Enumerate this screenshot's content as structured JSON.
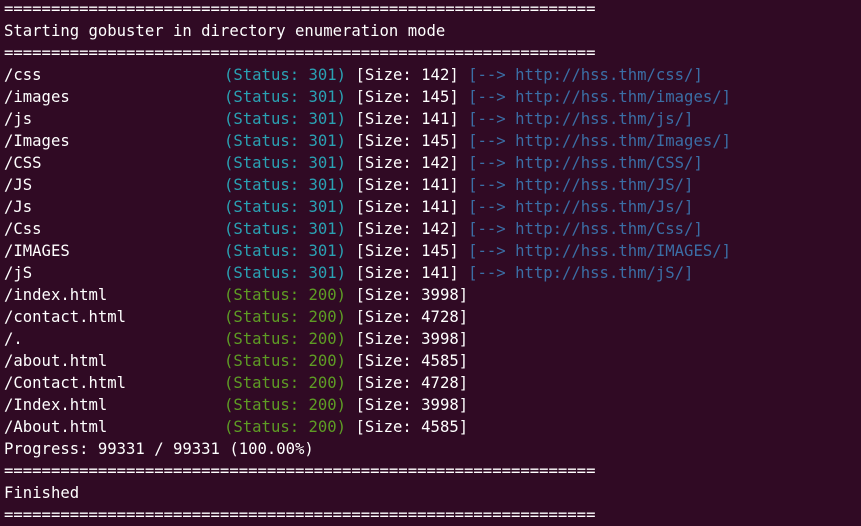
{
  "terminal": {
    "separator": "===============================================================",
    "header": "Starting gobuster in directory enumeration mode",
    "results": [
      {
        "path": "/css",
        "status": "(Status: 301)",
        "code": "301",
        "size": "[Size: 142]",
        "redirect": "[--> http://hss.thm/css/]"
      },
      {
        "path": "/images",
        "status": "(Status: 301)",
        "code": "301",
        "size": "[Size: 145]",
        "redirect": "[--> http://hss.thm/images/]"
      },
      {
        "path": "/js",
        "status": "(Status: 301)",
        "code": "301",
        "size": "[Size: 141]",
        "redirect": "[--> http://hss.thm/js/]"
      },
      {
        "path": "/Images",
        "status": "(Status: 301)",
        "code": "301",
        "size": "[Size: 145]",
        "redirect": "[--> http://hss.thm/Images/]"
      },
      {
        "path": "/CSS",
        "status": "(Status: 301)",
        "code": "301",
        "size": "[Size: 142]",
        "redirect": "[--> http://hss.thm/CSS/]"
      },
      {
        "path": "/JS",
        "status": "(Status: 301)",
        "code": "301",
        "size": "[Size: 141]",
        "redirect": "[--> http://hss.thm/JS/]"
      },
      {
        "path": "/Js",
        "status": "(Status: 301)",
        "code": "301",
        "size": "[Size: 141]",
        "redirect": "[--> http://hss.thm/Js/]"
      },
      {
        "path": "/Css",
        "status": "(Status: 301)",
        "code": "301",
        "size": "[Size: 142]",
        "redirect": "[--> http://hss.thm/Css/]"
      },
      {
        "path": "/IMAGES",
        "status": "(Status: 301)",
        "code": "301",
        "size": "[Size: 145]",
        "redirect": "[--> http://hss.thm/IMAGES/]"
      },
      {
        "path": "/jS",
        "status": "(Status: 301)",
        "code": "301",
        "size": "[Size: 141]",
        "redirect": "[--> http://hss.thm/jS/]"
      },
      {
        "path": "/index.html",
        "status": "(Status: 200)",
        "code": "200",
        "size": "[Size: 3998]",
        "redirect": ""
      },
      {
        "path": "/contact.html",
        "status": "(Status: 200)",
        "code": "200",
        "size": "[Size: 4728]",
        "redirect": ""
      },
      {
        "path": "/.",
        "status": "(Status: 200)",
        "code": "200",
        "size": "[Size: 3998]",
        "redirect": ""
      },
      {
        "path": "/about.html",
        "status": "(Status: 200)",
        "code": "200",
        "size": "[Size: 4585]",
        "redirect": ""
      },
      {
        "path": "/Contact.html",
        "status": "(Status: 200)",
        "code": "200",
        "size": "[Size: 4728]",
        "redirect": ""
      },
      {
        "path": "/Index.html",
        "status": "(Status: 200)",
        "code": "200",
        "size": "[Size: 3998]",
        "redirect": ""
      },
      {
        "path": "/About.html",
        "status": "(Status: 200)",
        "code": "200",
        "size": "[Size: 4585]",
        "redirect": ""
      }
    ],
    "progress": "Progress: 99331 / 99331 (100.00%)",
    "finished": "Finished"
  },
  "colors": {
    "background": "#300a24",
    "foreground": "#ffffff",
    "status_301": "#2aa1b3",
    "status_200": "#5e9c24",
    "redirect": "#3b6ea5"
  }
}
